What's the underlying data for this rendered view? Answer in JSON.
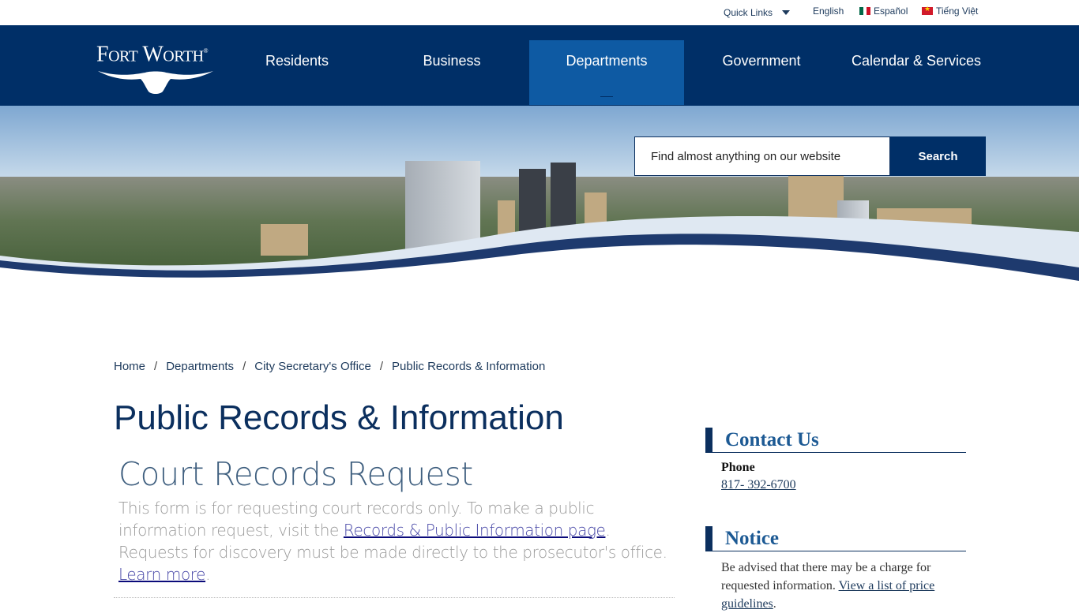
{
  "utility_bar": {
    "quick_links": "Quick Links",
    "languages": [
      {
        "label": "English",
        "flag": "none"
      },
      {
        "label": "Español",
        "flag": "mexico-flag"
      },
      {
        "label": "Tiếng Việt",
        "flag": "vietnam-flag"
      }
    ]
  },
  "nav": {
    "logo_text": "Fort Worth",
    "logo_mark": "®",
    "items": [
      {
        "label": "Residents",
        "active": false
      },
      {
        "label": "Business",
        "active": false
      },
      {
        "label": "Departments",
        "active": true
      },
      {
        "label": "Government",
        "active": false
      },
      {
        "label": "Calendar & Services",
        "active": false
      }
    ]
  },
  "search": {
    "placeholder": "Find almost anything on our website",
    "button_label": "Search"
  },
  "breadcrumb": [
    "Home",
    "Departments",
    "City Secretary's Office",
    "Public Records & Information"
  ],
  "page_title": "Public Records & Information",
  "form": {
    "title": "Court Records Request",
    "desc_1": "This form is for requesting court records only. To make a public information request, visit the ",
    "link_1": "Records & Public Information page",
    "desc_2": ". Requests for discovery must be made directly to the prosecutor's office. ",
    "link_2": "Learn more",
    "desc_3": "."
  },
  "sidebar": {
    "contact": {
      "heading": "Contact Us",
      "phone_label": "Phone",
      "phone": "817- 392-6700"
    },
    "notice": {
      "heading": "Notice",
      "text": "Be advised that there may be a charge for requested information. ",
      "link": "View a list of price guidelines",
      "after": "."
    }
  },
  "colors": {
    "brand_navy": "#002f67",
    "active_nav": "#0e5aa3",
    "heading_blue": "#1d5a94"
  }
}
